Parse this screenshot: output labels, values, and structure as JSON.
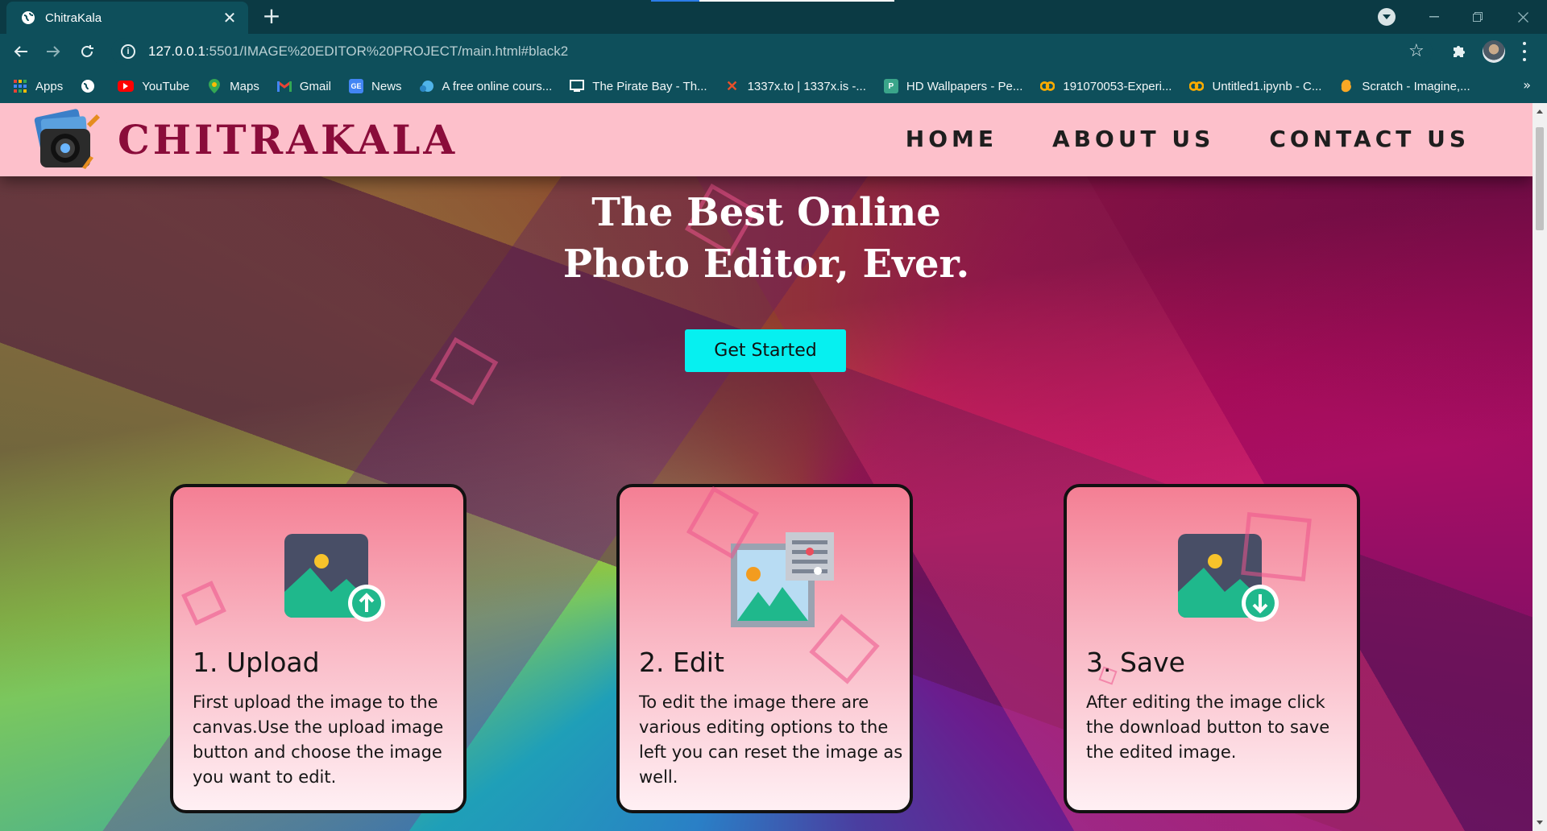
{
  "browser": {
    "tab_title": "ChitraKala",
    "url_host": "127.0.0.1",
    "url_path": ":5501/IMAGE%20EDITOR%20PROJECT/main.html#black2",
    "bookmarks": [
      {
        "label": "Apps",
        "icon": "apps-grid-icon"
      },
      {
        "label": "",
        "icon": "globe-icon"
      },
      {
        "label": "YouTube",
        "icon": "youtube-icon"
      },
      {
        "label": "Maps",
        "icon": "maps-icon"
      },
      {
        "label": "Gmail",
        "icon": "gmail-icon"
      },
      {
        "label": "News",
        "icon": "news-icon"
      },
      {
        "label": "A free online cours...",
        "icon": "course-icon"
      },
      {
        "label": "The Pirate Bay - Th...",
        "icon": "piratebay-icon"
      },
      {
        "label": "1337x.to | 1337x.is -...",
        "icon": "x-icon"
      },
      {
        "label": "HD Wallpapers - Pe...",
        "icon": "wallpaper-icon"
      },
      {
        "label": "191070053-Experi...",
        "icon": "colab-icon"
      },
      {
        "label": "Untitled1.ipynb - C...",
        "icon": "colab-icon"
      },
      {
        "label": "Scratch - Imagine,...",
        "icon": "scratch-icon"
      }
    ],
    "bookmarks_more": "»"
  },
  "site": {
    "brand": "CHITRAKALA",
    "nav": {
      "home": "HOME",
      "about": "ABOUT US",
      "contact": "CONTACT US"
    },
    "hero_line1": "The Best Online",
    "hero_line2": "Photo Editor, Ever.",
    "cta": "Get Started",
    "cards": [
      {
        "title": "1. Upload",
        "text": "First upload the image to the canvas.Use the upload image button and choose the image you want to edit.",
        "icon": "image-upload-icon"
      },
      {
        "title": "2. Edit",
        "text": "To edit the image there are various editing options to the left you can reset the image as well.",
        "icon": "image-edit-icon"
      },
      {
        "title": "3. Save",
        "text": "After editing the image click the download button to save the edited image.",
        "icon": "image-download-icon"
      }
    ]
  },
  "colors": {
    "nav_bg": "#fdc0cb",
    "brand": "#8a0c3a",
    "cta": "#06f0f0",
    "chrome": "#0e4f5b"
  }
}
